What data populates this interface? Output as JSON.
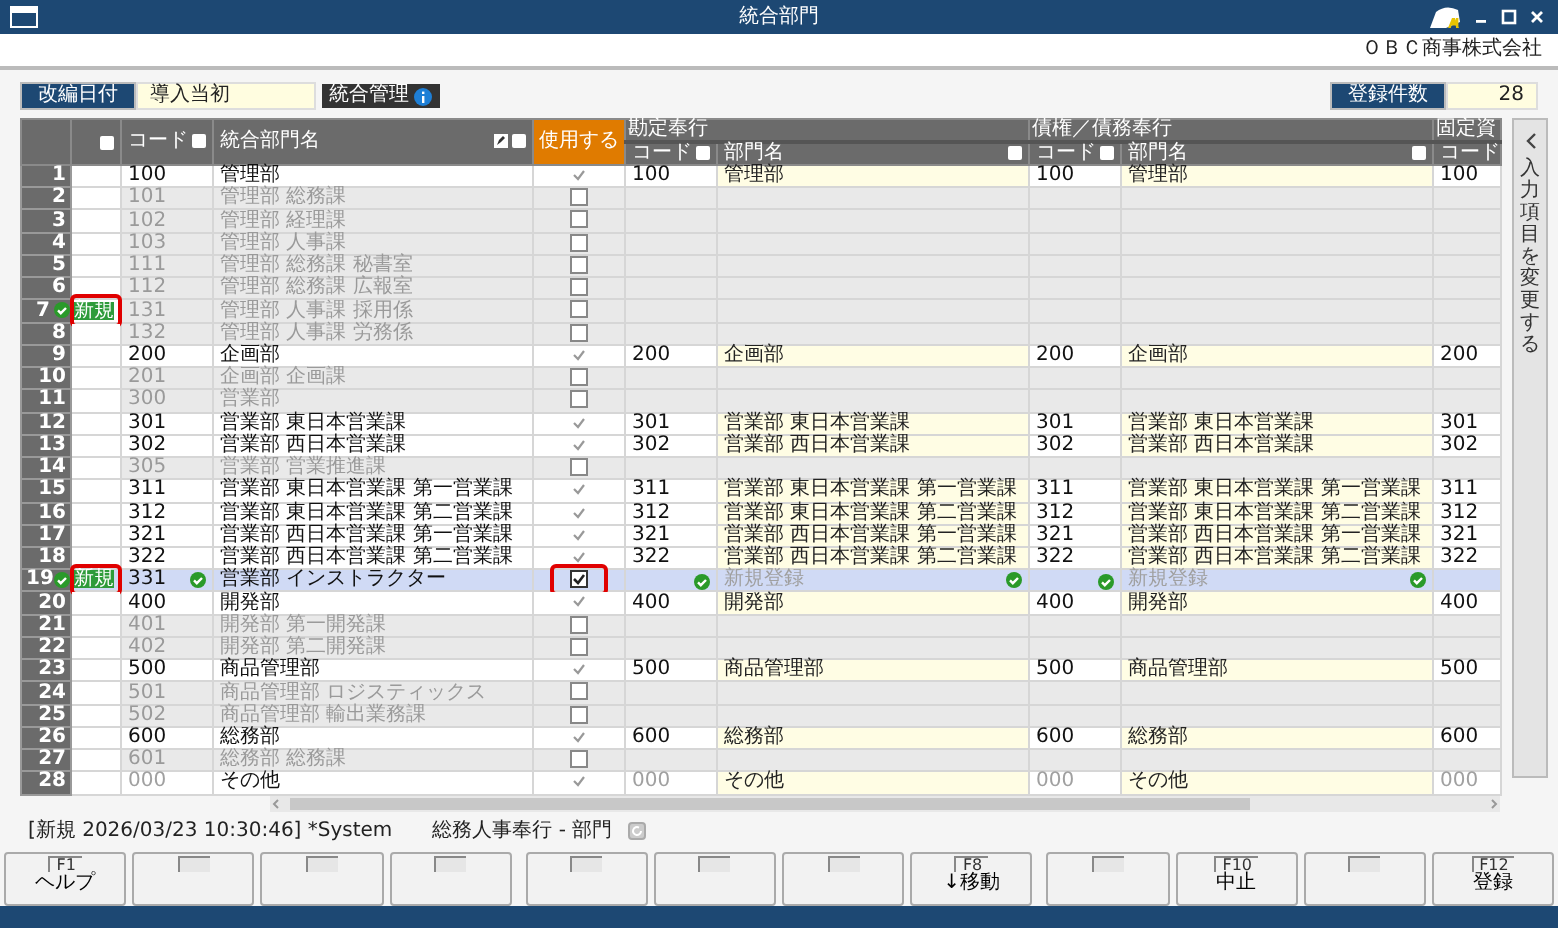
{
  "window": {
    "title": "統合部門"
  },
  "company": "ＯＢＣ商事株式会社",
  "toolbar": {
    "revision_label": "改編日付",
    "revision_value": "導入当初",
    "mode_label": "統合管理",
    "count_label": "登録件数",
    "count_value": "28"
  },
  "table": {
    "columns": [
      "コード",
      "統合部門名",
      "使用する"
    ],
    "groups": [
      {
        "title": "勘定奉行",
        "columns": [
          "コード",
          "部門名"
        ]
      },
      {
        "title": "債権／債務奉行",
        "columns": [
          "コード",
          "部門名"
        ]
      },
      {
        "title": "固定資",
        "columns": [
          "コード"
        ]
      }
    ],
    "rows": [
      {
        "number": "1",
        "code": "100",
        "name": "管理部",
        "use": true,
        "selected": false,
        "links": [
          {
            "code": "100",
            "name": "管理部"
          },
          {
            "code": "100",
            "name": "管理部"
          }
        ],
        "fixed_code": "100"
      },
      {
        "number": "2",
        "code": "101",
        "name": "管理部 総務課",
        "use": false,
        "selected": false
      },
      {
        "number": "3",
        "code": "102",
        "name": "管理部 経理課",
        "use": false,
        "selected": false
      },
      {
        "number": "4",
        "code": "103",
        "name": "管理部 人事課",
        "use": false,
        "selected": false
      },
      {
        "number": "5",
        "code": "111",
        "name": "管理部 総務課 秘書室",
        "use": false,
        "selected": false
      },
      {
        "number": "6",
        "code": "112",
        "name": "管理部 総務課 広報室",
        "use": false,
        "selected": false
      },
      {
        "number": "7",
        "code": "131",
        "name": "管理部 人事課 採用係",
        "use": false,
        "selected": false,
        "ok": true,
        "badge": "新規",
        "badge_framed": true
      },
      {
        "number": "8",
        "code": "132",
        "name": "管理部 人事課 労務係",
        "use": false,
        "selected": false
      },
      {
        "number": "9",
        "code": "200",
        "name": "企画部",
        "use": true,
        "selected": false,
        "links": [
          {
            "code": "200",
            "name": "企画部"
          },
          {
            "code": "200",
            "name": "企画部"
          }
        ],
        "fixed_code": "200"
      },
      {
        "number": "10",
        "code": "201",
        "name": "企画部 企画課",
        "use": false,
        "selected": false
      },
      {
        "number": "11",
        "code": "300",
        "name": "営業部",
        "use": false,
        "selected": false
      },
      {
        "number": "12",
        "code": "301",
        "name": "営業部 東日本営業課",
        "use": true,
        "selected": false,
        "links": [
          {
            "code": "301",
            "name": "営業部 東日本営業課"
          },
          {
            "code": "301",
            "name": "営業部 東日本営業課"
          }
        ],
        "fixed_code": "301"
      },
      {
        "number": "13",
        "code": "302",
        "name": "営業部 西日本営業課",
        "use": true,
        "selected": false,
        "links": [
          {
            "code": "302",
            "name": "営業部 西日本営業課"
          },
          {
            "code": "302",
            "name": "営業部 西日本営業課"
          }
        ],
        "fixed_code": "302"
      },
      {
        "number": "14",
        "code": "305",
        "name": "営業部 営業推進課",
        "use": false,
        "selected": false
      },
      {
        "number": "15",
        "code": "311",
        "name": "営業部 東日本営業課 第一営業課",
        "use": true,
        "selected": false,
        "links": [
          {
            "code": "311",
            "name": "営業部 東日本営業課 第一営業課"
          },
          {
            "code": "311",
            "name": "営業部 東日本営業課 第一営業課"
          }
        ],
        "fixed_code": "311"
      },
      {
        "number": "16",
        "code": "312",
        "name": "営業部 東日本営業課 第二営業課",
        "use": true,
        "selected": false,
        "links": [
          {
            "code": "312",
            "name": "営業部 東日本営業課 第二営業課"
          },
          {
            "code": "312",
            "name": "営業部 東日本営業課 第二営業課"
          }
        ],
        "fixed_code": "312"
      },
      {
        "number": "17",
        "code": "321",
        "name": "営業部 西日本営業課 第一営業課",
        "use": true,
        "selected": false,
        "links": [
          {
            "code": "321",
            "name": "営業部 西日本営業課 第一営業課"
          },
          {
            "code": "321",
            "name": "営業部 西日本営業課 第一営業課"
          }
        ],
        "fixed_code": "321"
      },
      {
        "number": "18",
        "code": "322",
        "name": "営業部 西日本営業課 第二営業課",
        "use": true,
        "selected": false,
        "links": [
          {
            "code": "322",
            "name": "営業部 西日本営業課 第二営業課"
          },
          {
            "code": "322",
            "name": "営業部 西日本営業課 第二営業課"
          }
        ],
        "fixed_code": "322"
      },
      {
        "number": "19",
        "code": "331",
        "name": "営業部 インストラクター",
        "use": true,
        "selected": true,
        "ok": true,
        "badge": "新規",
        "badge_framed": true,
        "use_framed": true,
        "validated": true,
        "links": [
          {
            "name": "新規登録",
            "pending": true
          },
          {
            "name": "新規登録",
            "pending": true
          }
        ]
      },
      {
        "number": "20",
        "code": "400",
        "name": "開発部",
        "use": true,
        "selected": false,
        "links": [
          {
            "code": "400",
            "name": "開発部"
          },
          {
            "code": "400",
            "name": "開発部"
          }
        ],
        "fixed_code": "400"
      },
      {
        "number": "21",
        "code": "401",
        "name": "開発部 第一開発課",
        "use": false,
        "selected": false
      },
      {
        "number": "22",
        "code": "402",
        "name": "開発部 第二開発課",
        "use": false,
        "selected": false
      },
      {
        "number": "23",
        "code": "500",
        "name": "商品管理部",
        "use": true,
        "selected": false,
        "links": [
          {
            "code": "500",
            "name": "商品管理部"
          },
          {
            "code": "500",
            "name": "商品管理部"
          }
        ],
        "fixed_code": "500"
      },
      {
        "number": "24",
        "code": "501",
        "name": "商品管理部 ロジスティックス",
        "use": false,
        "selected": false
      },
      {
        "number": "25",
        "code": "502",
        "name": "商品管理部 輸出業務課",
        "use": false,
        "selected": false
      },
      {
        "number": "26",
        "code": "600",
        "name": "総務部",
        "use": true,
        "selected": false,
        "links": [
          {
            "code": "600",
            "name": "総務部"
          },
          {
            "code": "600",
            "name": "総務部"
          }
        ],
        "fixed_code": "600"
      },
      {
        "number": "27",
        "code": "601",
        "name": "総務部 総務課",
        "use": false,
        "selected": false
      },
      {
        "number": "28",
        "code": "000",
        "name": "その他",
        "use": true,
        "selected": false,
        "code_dim": true,
        "links": [
          {
            "code": "000",
            "name": "その他",
            "code_dim": true
          },
          {
            "code": "000",
            "name": "その他",
            "code_dim": true
          }
        ],
        "fixed_code": "000",
        "fixed_code_dim": true
      }
    ]
  },
  "side_panel": {
    "label": "入力項目を変更する"
  },
  "status": {
    "record": "[新規 2026/03/23 10:30:46] *System",
    "module": "総務人事奉行 - 部門"
  },
  "function_keys": [
    {
      "kind": "key",
      "key": "F1",
      "label": "ヘルプ"
    },
    {
      "kind": "blank"
    },
    {
      "kind": "blank"
    },
    {
      "kind": "blank"
    },
    {
      "kind": "blank"
    },
    {
      "kind": "blank"
    },
    {
      "kind": "blank"
    },
    {
      "kind": "key",
      "key": "F8",
      "label": "↓移動"
    },
    {
      "kind": "blank"
    },
    {
      "kind": "key",
      "key": "F10",
      "label": "中止"
    },
    {
      "kind": "blank"
    },
    {
      "kind": "key",
      "key": "F12",
      "label": "登録"
    }
  ]
}
